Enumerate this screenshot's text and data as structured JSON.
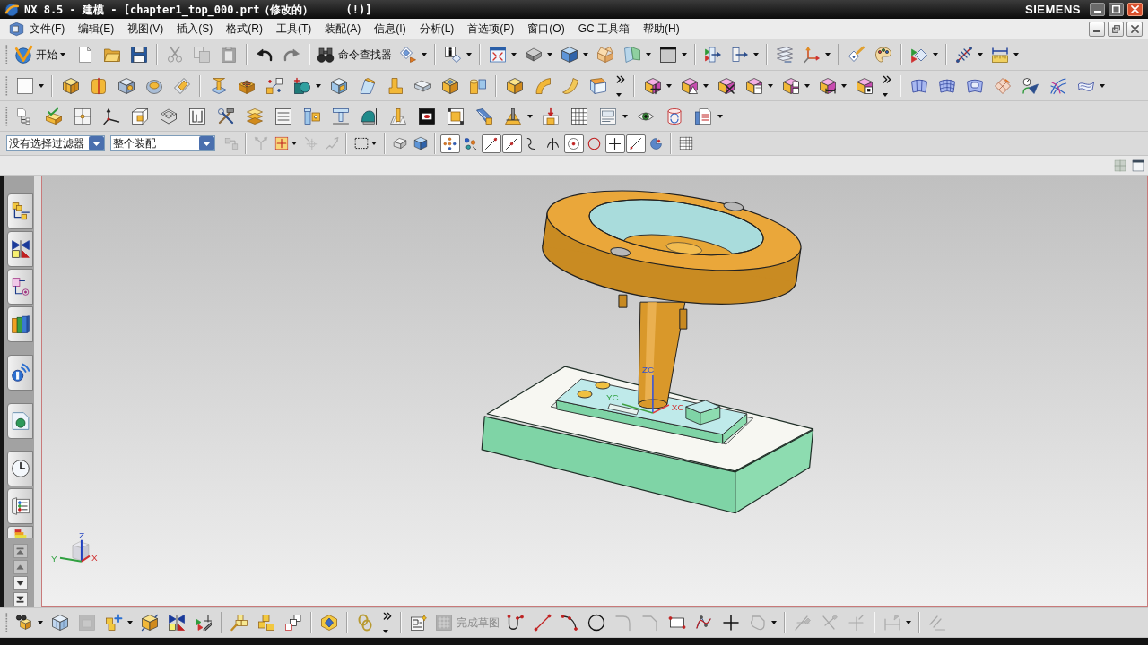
{
  "title_bar": {
    "title": "NX 8.5 - 建模 - [chapter1_top_000.prt（修改的）     (!)]",
    "brand": "SIEMENS"
  },
  "menu_bar": {
    "items": [
      "文件(F)",
      "编辑(E)",
      "视图(V)",
      "插入(S)",
      "格式(R)",
      "工具(T)",
      "装配(A)",
      "信息(I)",
      "分析(L)",
      "首选项(P)",
      "窗口(O)",
      "GC 工具箱",
      "帮助(H)"
    ]
  },
  "standard_toolbar": {
    "start_button": {
      "label": "开始"
    },
    "clipboard_buttons": [
      {
        "disabled": true
      },
      {
        "disabled": true
      },
      {
        "disabled": true
      }
    ],
    "history_buttons": [
      {
        "disabled": false
      },
      {
        "disabled": true
      }
    ],
    "command_finder": {
      "label": "命令查找器"
    }
  },
  "selection_bar": {
    "type_filter": {
      "value": "没有选择过滤器"
    },
    "scope": {
      "value": "整个装配"
    },
    "filter_tools": [
      {
        "disabled": true
      },
      {
        "disabled": true
      },
      {
        "disabled": false
      },
      {
        "disabled": true
      },
      {
        "disabled": true
      }
    ],
    "snap_points": [
      {
        "on": true
      },
      {
        "on": false
      },
      {
        "on": true
      },
      {
        "on": true
      },
      {
        "on": false
      },
      {
        "on": false
      },
      {
        "on": true
      },
      {
        "on": false
      },
      {
        "on": true
      },
      {
        "on": true
      },
      {
        "on": false
      }
    ]
  },
  "resource_bar": {
    "scroll_buttons": [
      {
        "disabled": true
      },
      {
        "disabled": true
      },
      {
        "disabled": false
      },
      {
        "disabled": false
      }
    ]
  },
  "graphics_window": {
    "wcs_labels": {
      "z": "ZC",
      "y": "YC",
      "x": "XC"
    },
    "view_triad_labels": {
      "z": "Z",
      "y": "Y",
      "x": "X"
    }
  },
  "bottom_toolbar": {
    "assembly_tools": [
      {
        "disabled": false
      },
      {
        "disabled": false
      },
      {
        "disabled": true
      },
      {
        "disabled": false
      },
      {
        "disabled": false
      },
      {
        "disabled": false
      },
      {
        "disabled": false
      },
      {
        "disabled": false
      },
      {
        "disabled": false
      },
      {
        "disabled": false
      },
      {
        "disabled": false
      },
      {
        "disabled": false
      }
    ],
    "finish_sketch": {
      "label": "完成草图",
      "disabled": true
    },
    "curve_tools": [
      {
        "disabled": false
      },
      {
        "disabled": false
      },
      {
        "disabled": false
      },
      {
        "disabled": false
      },
      {
        "disabled": true
      },
      {
        "disabled": true
      },
      {
        "disabled": false
      },
      {
        "disabled": false
      },
      {
        "disabled": false
      },
      {
        "disabled": true
      },
      {
        "disabled": true
      },
      {
        "disabled": true
      },
      {
        "disabled": true
      },
      {
        "disabled": true
      },
      {
        "disabled": true
      }
    ]
  }
}
